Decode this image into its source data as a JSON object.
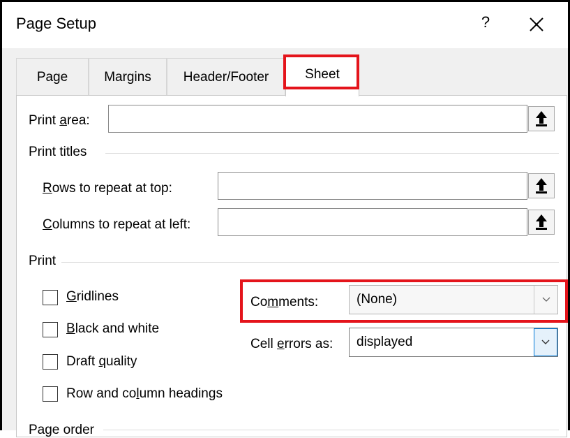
{
  "dialog": {
    "title": "Page Setup",
    "help_label": "?",
    "close_icon": "close-icon"
  },
  "tabs": [
    {
      "label": "Page",
      "active": false
    },
    {
      "label": "Margins",
      "active": false
    },
    {
      "label": "Header/Footer",
      "active": false
    },
    {
      "label": "Sheet",
      "active": true
    }
  ],
  "print_area": {
    "label_pre": "Print ",
    "label_u": "a",
    "label_post": "rea:",
    "value": ""
  },
  "print_titles": {
    "heading": "Print titles",
    "rows": {
      "label_u": "R",
      "label_post": "ows to repeat at top:",
      "value": ""
    },
    "columns": {
      "label_u": "C",
      "label_post": "olumns to repeat at left:",
      "value": ""
    }
  },
  "print": {
    "heading": "Print",
    "checkboxes": [
      {
        "pre": "",
        "u": "G",
        "post": "ridlines",
        "checked": false
      },
      {
        "pre": "",
        "u": "B",
        "post": "lack and white",
        "checked": false
      },
      {
        "pre": "Draft ",
        "u": "q",
        "post": "uality",
        "checked": false
      },
      {
        "pre": "Row and co",
        "u": "l",
        "post": "umn headings",
        "checked": false
      }
    ],
    "comments": {
      "label_pre": "Co",
      "label_u": "m",
      "label_post": "ments:",
      "value": "(None)"
    },
    "cell_errors": {
      "label_pre": "Cell ",
      "label_u": "e",
      "label_post": "rrors as:",
      "value": "displayed"
    }
  },
  "page_order": {
    "heading": "Page order"
  },
  "colors": {
    "highlight": "#e4141b",
    "accent": "#0078d7"
  }
}
